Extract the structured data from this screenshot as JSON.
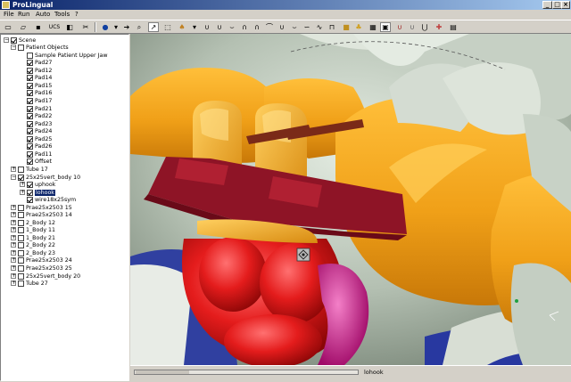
{
  "window": {
    "title": "ProLingual"
  },
  "menu": [
    "File",
    "Run",
    "Auto",
    "Tools",
    "?"
  ],
  "toolbar": {
    "text_button": "UCS"
  },
  "tree": {
    "root": "Scene",
    "group": "Patient Objects",
    "items": [
      "Sample Patient Upper Jaw",
      "Pad27",
      "Pad12",
      "Pad14",
      "Pad15",
      "Pad16",
      "Pad17",
      "Pad21",
      "Pad22",
      "Pad23",
      "Pad24",
      "Pad25",
      "Pad26",
      "Pad11",
      "Offset"
    ],
    "tube17": "Tube 17",
    "body10": "25x25vert_body 10",
    "body10_children": [
      "uphook",
      "lohook",
      "wire18x25sym"
    ],
    "rest": [
      "Prae25x2503 15",
      "Prae25x2503 14",
      "2_Body 12",
      "1_Body 11",
      "1_Body 21",
      "2_Body 22",
      "2_Body 23",
      "Prae25x2503 24",
      "Prae25x2503 25",
      "25x25vert_body 20",
      "Tube 27"
    ]
  },
  "status": {
    "label": "lohook"
  },
  "colors": {
    "gingiva": "#aeb9aa",
    "tooth": "#f2a21a",
    "attachment": "#f6b52c",
    "slot": "#8e1426",
    "body": "#e01818",
    "tube": "#d4148a",
    "selection": "#0a246a"
  },
  "icons": [
    "new-icon",
    "open-icon",
    "save-icon",
    "globe-icon",
    "arrow-icon",
    "zoom-icon",
    "pick-icon",
    "select-icon",
    "wire-icon",
    "tooth-icon",
    "camera-icon"
  ]
}
